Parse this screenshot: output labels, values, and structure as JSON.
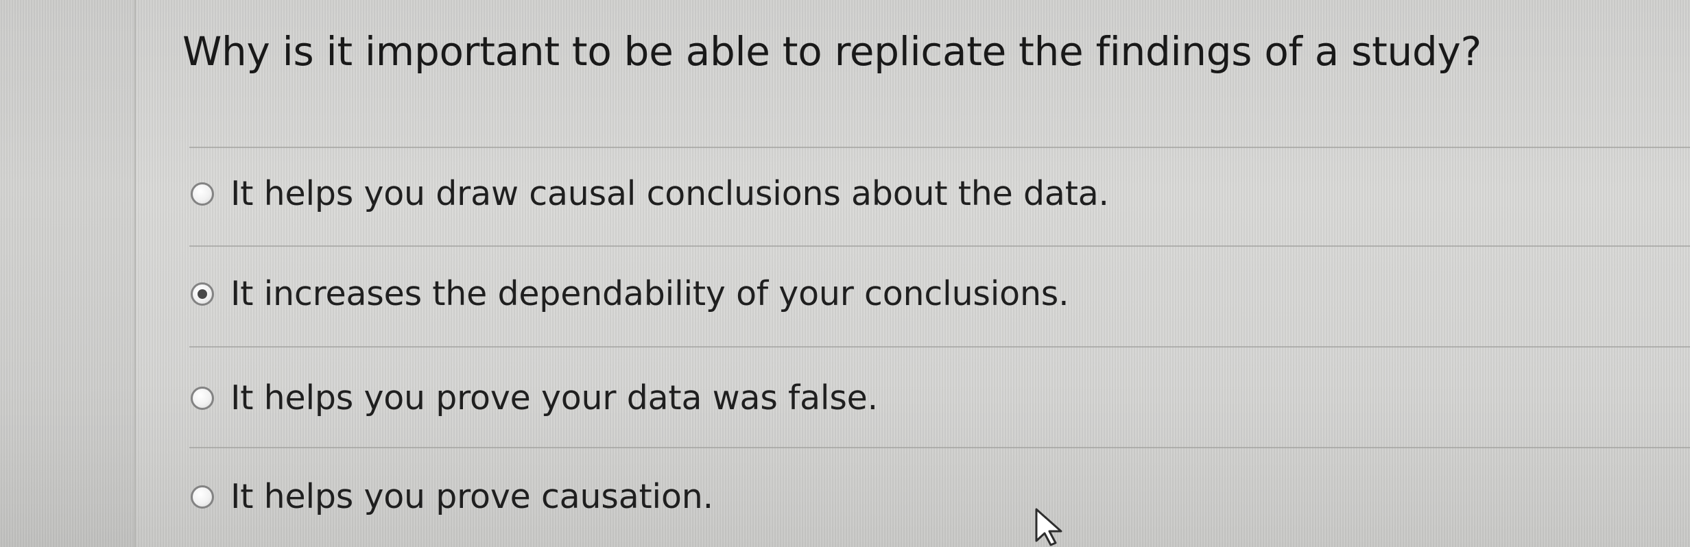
{
  "question": {
    "text": "Why is it important to be able to replicate the findings of a study?"
  },
  "options": [
    {
      "label": "It helps you draw causal conclusions about the data.",
      "selected": false
    },
    {
      "label": "It increases the dependability of your conclusions.",
      "selected": true
    },
    {
      "label": "It helps you prove your data was false.",
      "selected": false
    },
    {
      "label": "It helps you prove causation.",
      "selected": false
    }
  ],
  "icons": {
    "cursor": "mouse-pointer-icon"
  }
}
